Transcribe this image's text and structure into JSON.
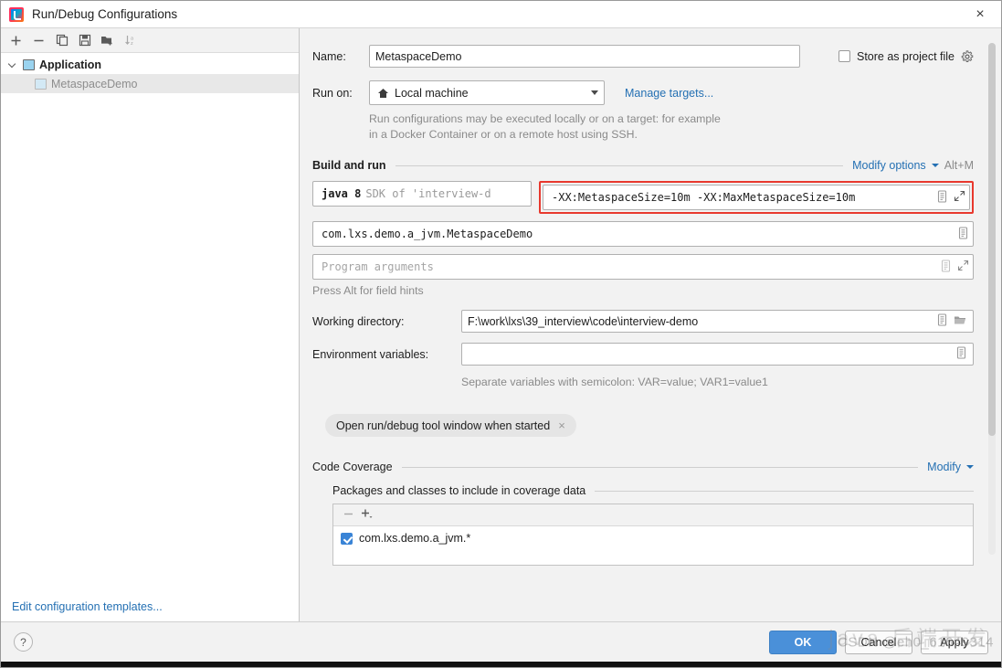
{
  "window": {
    "title": "Run/Debug Configurations",
    "app_icon": "intellij-idea-icon",
    "close_label": "×"
  },
  "sidebar": {
    "toolbar": [
      {
        "name": "add-button",
        "icon": "plus-icon",
        "label": "+"
      },
      {
        "name": "remove-button",
        "icon": "minus-icon",
        "label": "−"
      },
      {
        "name": "copy-button",
        "icon": "copy-icon",
        "label": "Copy"
      },
      {
        "name": "save-button",
        "icon": "save-icon",
        "label": "Save"
      },
      {
        "name": "move-to-folder-button",
        "icon": "folder-add-icon",
        "label": "Move into new folder"
      },
      {
        "name": "sort-button",
        "icon": "sort-alphabetical-icon",
        "label": "Sort configurations"
      }
    ],
    "tree": [
      {
        "label": "Application",
        "icon": "application-icon",
        "expanded": true,
        "selected": false
      },
      {
        "label": "MetaspaceDemo",
        "icon": "application-icon",
        "child": true,
        "selected": true
      }
    ],
    "footer_link": "Edit configuration templates..."
  },
  "form": {
    "name_label": "Name:",
    "name_value": "MetaspaceDemo",
    "store_as_project_file_label": "Store as project file",
    "store_as_project_file_checked": false,
    "store_gear_icon": "gear-icon",
    "run_on_label": "Run on:",
    "run_on_value": "Local machine",
    "run_on_icon": "home-icon",
    "manage_targets_link": "Manage targets...",
    "run_on_hint_line1": "Run configurations may be executed locally or on a target: for example",
    "run_on_hint_line2": "in a Docker Container or on a remote host using SSH."
  },
  "build_and_run": {
    "section_title": "Build and run",
    "modify_options_link": "Modify options",
    "modify_options_shortcut": "Alt+M",
    "jdk_bold": "java 8",
    "jdk_gray": "SDK of 'interview-d",
    "vm_options_value": "-XX:MetaspaceSize=10m -XX:MaxMetaspaceSize=10m",
    "vm_options_highlight_color": "#e8392e",
    "main_class_value": "com.lxs.demo.a_jvm.MetaspaceDemo",
    "program_arguments_placeholder": "Program arguments",
    "program_arguments_value": "",
    "press_alt_hint": "Press Alt for field hints",
    "working_directory_label": "Working directory:",
    "working_directory_value": "F:\\work\\lxs\\39_interview\\code\\interview-demo",
    "environment_variables_label": "Environment variables:",
    "environment_variables_value": "",
    "environment_variables_hint": "Separate variables with semicolon: VAR=value; VAR1=value1",
    "option_tag": "Open run/debug tool window when started",
    "option_tag_close": "×"
  },
  "code_coverage": {
    "section_title": "Code Coverage",
    "modify_link": "Modify",
    "packages_title": "Packages and classes to include in coverage data",
    "toolbar": [
      {
        "name": "coverage-remove-button",
        "icon": "minus-icon",
        "label": "−"
      },
      {
        "name": "coverage-add-button",
        "icon": "plus-dropdown-icon",
        "label": "+"
      }
    ],
    "items": [
      {
        "label": "com.lxs.demo.a_jvm.*",
        "checked": true
      }
    ]
  },
  "footer": {
    "help_label": "?",
    "ok_label": "OK",
    "cancel_label": "Cancel",
    "apply_label": "Apply",
    "watermark": "CSDN @eh0_61649314",
    "watermark_cn": "java 后端开发"
  }
}
